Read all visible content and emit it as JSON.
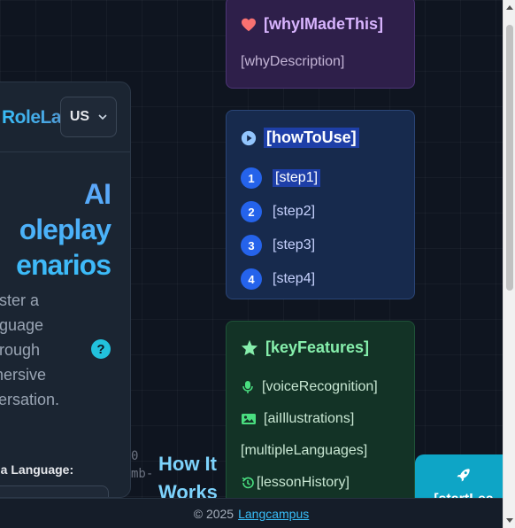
{
  "header": {
    "logo_text": "RoleLang",
    "language_selector": "US"
  },
  "hero": {
    "title_lines": [
      "AI",
      "oleplay",
      "enarios"
    ],
    "description_lines": [
      "aster a",
      "nguage",
      "hrough",
      "mersive",
      "versation."
    ],
    "help_icon": "?",
    "choose_label": "e a Language:"
  },
  "cards": {
    "why": {
      "title": "[whyIMadeThis]",
      "description": "[whyDescription]",
      "icon": "heart-icon"
    },
    "how": {
      "title": "[howToUse]",
      "icon": "play-circle-icon",
      "steps": [
        {
          "num": "1",
          "label": "[step1]"
        },
        {
          "num": "2",
          "label": "[step2]"
        },
        {
          "num": "3",
          "label": "[step3]"
        },
        {
          "num": "4",
          "label": "[step4]"
        }
      ]
    },
    "key": {
      "title": "[keyFeatures]",
      "icon": "star-icon",
      "features": [
        {
          "label": "[voiceRecognition]",
          "icon": "microphone-icon"
        },
        {
          "label": "[aiIllustrations]",
          "icon": "image-icon"
        },
        {
          "label": "[multipleLanguages]",
          "icon": ""
        },
        {
          "label": "[lessonHistory]",
          "icon": "history-icon"
        }
      ]
    }
  },
  "how_it_works": {
    "title_line1": "How It",
    "title_line2": "Works",
    "code_line1": "0",
    "code_line2": "mb-"
  },
  "start_button": {
    "label": "[startLea",
    "icon": "rocket-icon"
  },
  "footer": {
    "copyright": "© 2025",
    "link": "Langcampus"
  },
  "colors": {
    "accent": "#38bdf8",
    "why_card": "#2e1f4a",
    "how_card": "#172a4d",
    "key_card": "#133326",
    "step_badge": "#2563eb"
  }
}
